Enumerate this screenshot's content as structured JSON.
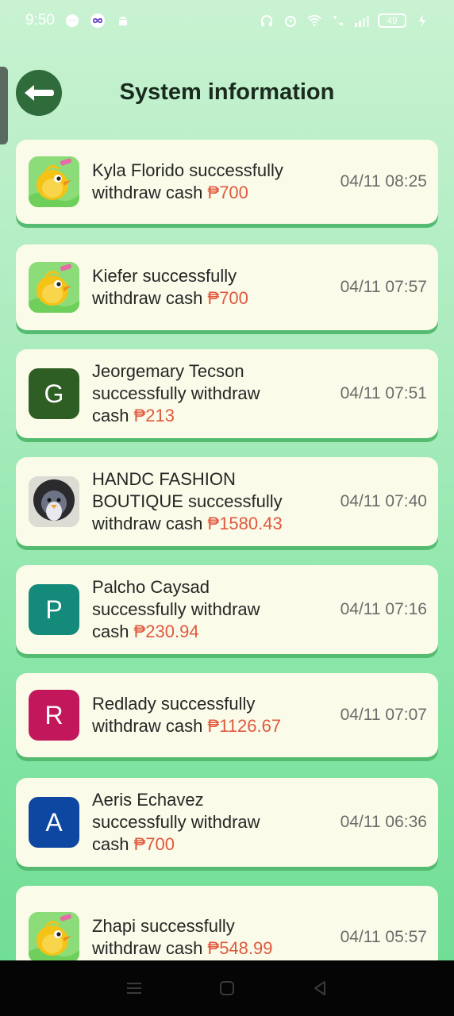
{
  "status_bar": {
    "time": "9:50",
    "battery": "49",
    "icons_left": [
      "messenger-icon",
      "infinity-app-icon",
      "android-icon"
    ],
    "icons_right": [
      "headphones-icon",
      "alarm-icon",
      "wifi-icon",
      "wifi-calling-icon",
      "signal-icon",
      "battery-icon",
      "charging-icon"
    ]
  },
  "header": {
    "back_icon": "arrow-left-icon",
    "title": "System information"
  },
  "colors": {
    "accent_green": "#2f6b3b",
    "amount_red": "#e0593e",
    "card_bg": "#fbfbe9"
  },
  "notifications": [
    {
      "avatar_type": "chick-image",
      "avatar_letter": "",
      "avatar_color": "",
      "name": "Kyla Florido ",
      "action": "successfully withdraw cash",
      "line1": "Kyla Florido  successfully",
      "line2": "withdraw cash",
      "line3": "",
      "amount": "₱700",
      "time": "04/11 08:25"
    },
    {
      "avatar_type": "chick-image",
      "avatar_letter": "",
      "avatar_color": "",
      "name": "Kiefer",
      "action": "successfully withdraw cash",
      "line1": "Kiefer  successfully",
      "line2": "withdraw cash",
      "line3": "",
      "amount": "₱700",
      "time": "04/11 07:57"
    },
    {
      "avatar_type": "letter",
      "avatar_letter": "G",
      "avatar_color": "#2e5e23",
      "name": "Jeorgemary Tecson",
      "line1": "Jeorgemary Tecson",
      "line2": "successfully withdraw",
      "line3": "cash",
      "amount": "₱213",
      "time": "04/11 07:51"
    },
    {
      "avatar_type": "photo",
      "avatar_letter": "",
      "avatar_color": "",
      "name": "HANDC FASHION BOUTIQUE",
      "line1": "HANDC FASHION",
      "line2": "BOUTIQUE  successfully",
      "line3": "withdraw cash",
      "amount": "₱1580.43",
      "time": "04/11 07:40"
    },
    {
      "avatar_type": "letter",
      "avatar_letter": "P",
      "avatar_color": "#138a7a",
      "name": "Palcho Caysad",
      "line1": "Palcho Caysad",
      "line2": "successfully withdraw",
      "line3": "cash",
      "amount": "₱230.94",
      "time": "04/11 07:16"
    },
    {
      "avatar_type": "letter",
      "avatar_letter": "R",
      "avatar_color": "#c2185b",
      "name": "Redlady",
      "line1": "Redlady  successfully",
      "line2": "withdraw cash",
      "line3": "",
      "amount": "₱1126.67",
      "time": "04/11 07:07"
    },
    {
      "avatar_type": "letter",
      "avatar_letter": "A",
      "avatar_color": "#0d47a1",
      "name": "Aeris Echavez",
      "line1": "Aeris Echavez",
      "line2": "successfully withdraw",
      "line3": "cash",
      "amount": "₱700",
      "time": "04/11 06:36"
    },
    {
      "avatar_type": "chick-image",
      "avatar_letter": "",
      "avatar_color": "",
      "name": "Zhapi",
      "line1": "Zhapi  successfully",
      "line2": "withdraw cash",
      "line3": "",
      "amount": "₱548.99",
      "time": "04/11 05:57"
    }
  ],
  "nav_bar": {
    "buttons": [
      "recent-apps-icon",
      "home-icon",
      "back-icon"
    ]
  }
}
